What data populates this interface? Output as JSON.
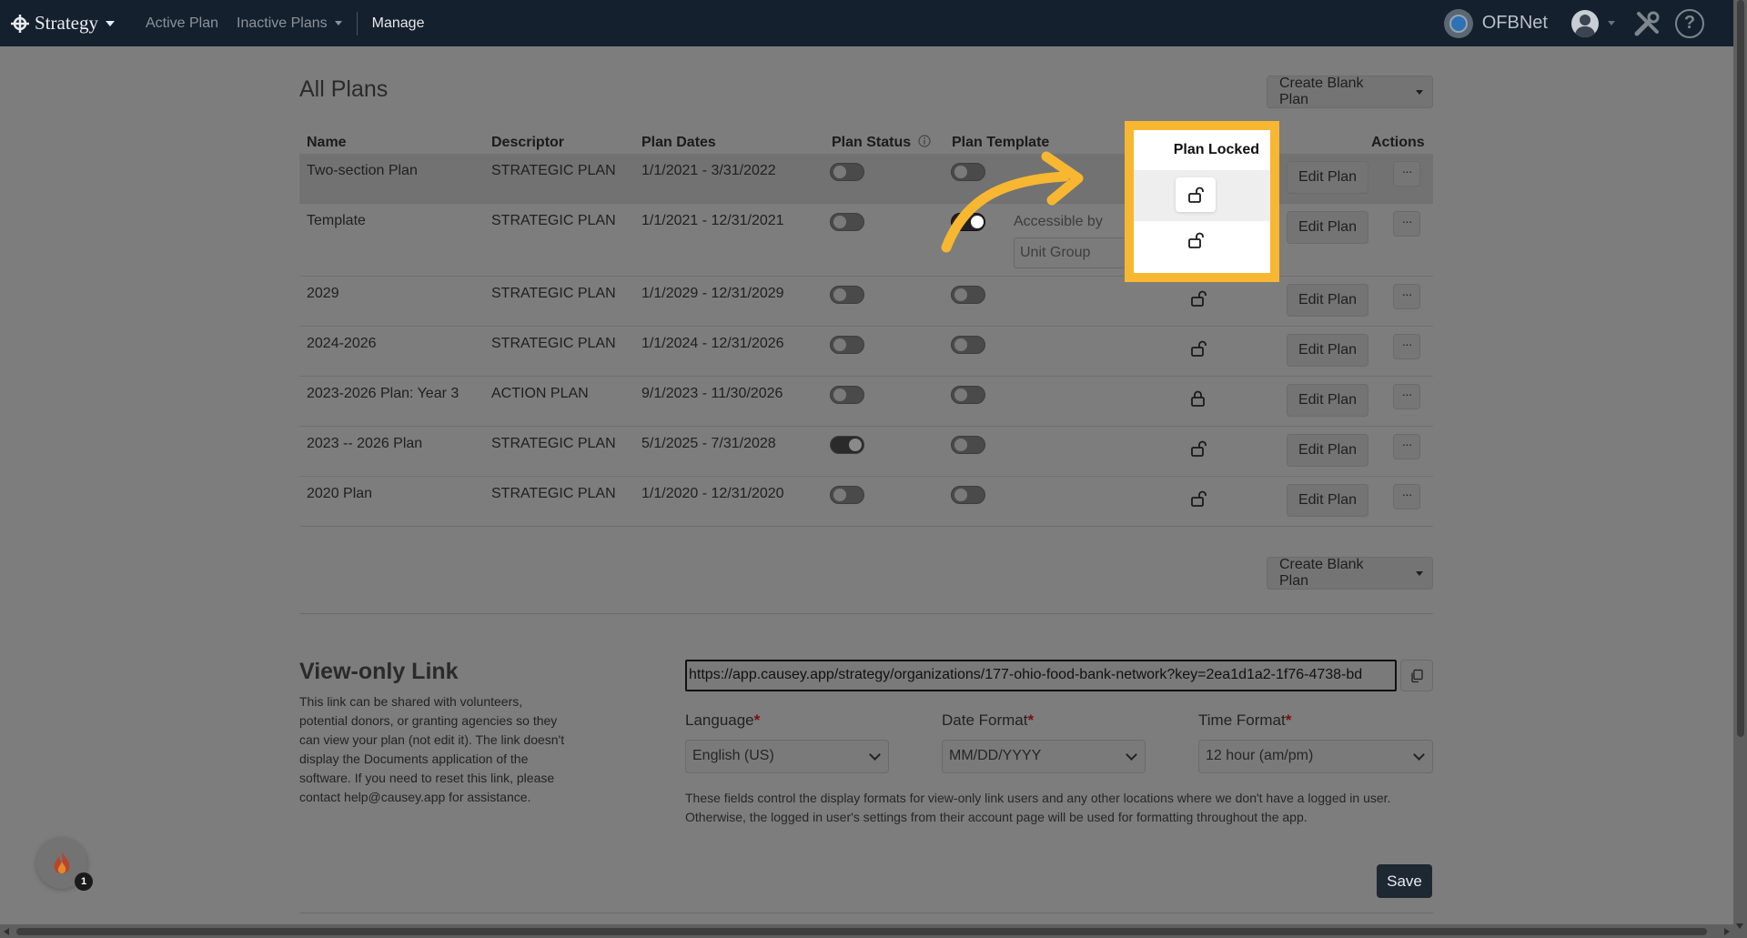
{
  "nav": {
    "brand": "Strategy",
    "items": [
      {
        "label": "Active Plan"
      },
      {
        "label": "Inactive Plans"
      },
      {
        "label": "Manage"
      }
    ],
    "org_name": "OFBNet"
  },
  "page": {
    "title": "All Plans",
    "create_blank_label": "Create Blank Plan"
  },
  "table": {
    "headers": {
      "name": "Name",
      "descriptor": "Descriptor",
      "plan_dates": "Plan Dates",
      "plan_status": "Plan Status",
      "plan_template": "Plan Template",
      "plan_locked": "Plan Locked",
      "actions": "Actions"
    },
    "rows": [
      {
        "name": "Two-section Plan",
        "descriptor": "STRATEGIC PLAN",
        "dates": "1/1/2021 - 3/31/2022",
        "status_on": false,
        "template_on": false,
        "locked": false,
        "edit": "Edit Plan"
      },
      {
        "name": "Template",
        "descriptor": "STRATEGIC PLAN",
        "dates": "1/1/2021 - 12/31/2021",
        "status_on": false,
        "template_on": true,
        "locked": false,
        "edit": "Edit Plan",
        "accessible_by_label": "Accessible by",
        "accessible_by_value": "Unit Group"
      },
      {
        "name": "2029",
        "descriptor": "STRATEGIC PLAN",
        "dates": "1/1/2029 - 12/31/2029",
        "status_on": false,
        "template_on": false,
        "locked": false,
        "edit": "Edit Plan"
      },
      {
        "name": "2024-2026",
        "descriptor": "STRATEGIC PLAN",
        "dates": "1/1/2024 - 12/31/2026",
        "status_on": false,
        "template_on": false,
        "locked": false,
        "edit": "Edit Plan"
      },
      {
        "name": "2023-2026 Plan: Year 3",
        "descriptor": "ACTION PLAN",
        "dates": "9/1/2023 - 11/30/2026",
        "status_on": false,
        "template_on": false,
        "locked": true,
        "edit": "Edit Plan"
      },
      {
        "name": "2023 -- 2026 Plan",
        "descriptor": "STRATEGIC PLAN",
        "dates": "5/1/2025 - 7/31/2028",
        "status_on": true,
        "template_on": false,
        "locked": false,
        "edit": "Edit Plan"
      },
      {
        "name": "2020 Plan",
        "descriptor": "STRATEGIC PLAN",
        "dates": "1/1/2020 - 12/31/2020",
        "status_on": false,
        "template_on": false,
        "locked": false,
        "edit": "Edit Plan"
      }
    ],
    "more_label": "···"
  },
  "view_only": {
    "title": "View-only Link",
    "description": "This link can be shared with volunteers, potential donors, or granting agencies so they can view your plan (not edit it). The link doesn't display the Documents application of the software. If you need to reset this link, please contact help@causey.app for assistance.",
    "link": "https://app.causey.app/strategy/organizations/177-ohio-food-bank-network?key=2ea1d1a2-1f76-4738-bd",
    "language_label": "Language",
    "language_value": "English (US)",
    "date_format_label": "Date Format",
    "date_format_value": "MM/DD/YYYY",
    "time_format_label": "Time Format",
    "time_format_value": "12 hour (am/pm)",
    "required_mark": "*",
    "note": "These fields control the display formats for view-only link users and any other locations where we don't have a logged in user. Otherwise, the logged in user's settings from their account page will be used for formatting throughout the app.",
    "save_label": "Save"
  },
  "notification_count": "1",
  "colors": {
    "highlight": "#f7b731",
    "navbar": "#15202e"
  }
}
